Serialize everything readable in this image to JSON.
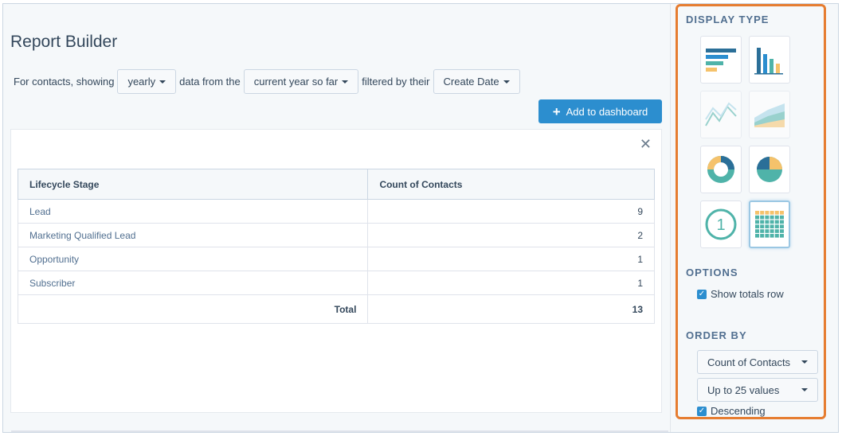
{
  "page": {
    "title": "Report Builder"
  },
  "filters": {
    "prefix": "For contacts, showing",
    "frequency": "yearly",
    "mid": "data from the",
    "range": "current year so far",
    "suffix": "filtered by their",
    "date_field": "Create Date"
  },
  "toolbar": {
    "add_label": "Add to dashboard"
  },
  "table": {
    "headers": [
      "Lifecycle Stage",
      "Count of Contacts"
    ],
    "rows": [
      {
        "stage": "Lead",
        "count": "9"
      },
      {
        "stage": "Marketing Qualified Lead",
        "count": "2"
      },
      {
        "stage": "Opportunity",
        "count": "1"
      },
      {
        "stage": "Subscriber",
        "count": "1"
      }
    ],
    "total_label": "Total",
    "total_value": "13"
  },
  "sidebar": {
    "display_type_title": "DISPLAY TYPE",
    "display_types": [
      {
        "icon": "horizontal-bar-chart-icon",
        "selected": false
      },
      {
        "icon": "vertical-bar-chart-icon",
        "selected": false
      },
      {
        "icon": "line-chart-icon",
        "selected": false
      },
      {
        "icon": "area-chart-icon",
        "selected": false
      },
      {
        "icon": "donut-chart-icon",
        "selected": false
      },
      {
        "icon": "pie-chart-icon",
        "selected": false
      },
      {
        "icon": "single-number-icon",
        "selected": false
      },
      {
        "icon": "table-icon",
        "selected": true
      }
    ],
    "single_number_glyph": "1",
    "options_title": "OPTIONS",
    "show_totals_label": "Show totals row",
    "order_title": "ORDER BY",
    "order_field": "Count of Contacts",
    "limit": "Up to 25 values",
    "descending_label": "Descending"
  },
  "colors": {
    "accent_blue": "#2c8ecf",
    "highlight_orange": "#e67d31",
    "teal": "#4fb3a9",
    "yellow": "#f5c26b",
    "navy": "#2b6f98"
  }
}
